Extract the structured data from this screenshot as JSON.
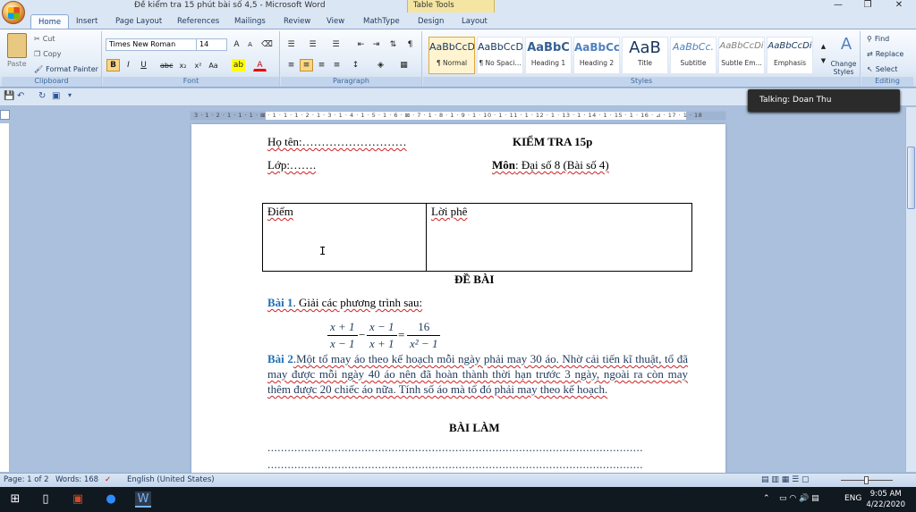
{
  "title_bar": {
    "document_title": "Đề kiểm tra 15 phút bài số 4,5 - Microsoft Word",
    "contextual_tab": "Table Tools",
    "minimize": "—",
    "restore": "❐",
    "close": "✕"
  },
  "tabs": [
    "Home",
    "Insert",
    "Page Layout",
    "References",
    "Mailings",
    "Review",
    "View",
    "MathType",
    "Design",
    "Layout"
  ],
  "clipboard": {
    "paste": "Paste",
    "cut": "Cut",
    "copy": "Copy",
    "format_painter": "Format Painter",
    "group_label": "Clipboard"
  },
  "font": {
    "family": "Times New Roman",
    "size": "14",
    "group_label": "Font"
  },
  "paragraph": {
    "group_label": "Paragraph"
  },
  "styles": {
    "items": [
      {
        "preview": "AaBbCcDc",
        "name": "¶ Normal"
      },
      {
        "preview": "AaBbCcDc",
        "name": "¶ No Spaci..."
      },
      {
        "preview": "AaBbC",
        "name": "Heading 1"
      },
      {
        "preview": "AaBbCc",
        "name": "Heading 2"
      },
      {
        "preview": "AaB",
        "name": "Title"
      },
      {
        "preview": "AaBbCc.",
        "name": "Subtitle"
      },
      {
        "preview": "AaBbCcDi",
        "name": "Subtle Em..."
      },
      {
        "preview": "AaBbCcDi",
        "name": "Emphasis"
      }
    ],
    "change_styles": "Change Styles",
    "group_label": "Styles"
  },
  "editing": {
    "find": "Find",
    "replace": "Replace",
    "select": "Select",
    "group_label": "Editing"
  },
  "talking": "Talking: Doan Thu",
  "ruler_text": "3 · 1 · 2 · 1 · 1 · 1 · ⊠ · 1 · 1 · 1 · 2 · 1 · 3 · 1 · 4 · 1 · 5 · 1 · 6 · ⊠ · 7 · 1 · 8 · 1 · 9 · 1 · 10 · 1 · 11 · 1 · 12 · 1 · 13 · 1 · 14 · 1 · 15 · 1 · 16 · ⊿ · 17 · 1 · 18",
  "document": {
    "name_label": "Họ tên:………………………",
    "class_label": "Lớp:…….",
    "test_title": "KIỂM TRA 15p",
    "subject_label": "Môn",
    "subject_value": ": Đại số  8 (Bài số 4)",
    "table_col1": "Điểm",
    "table_col2": "Lời phê",
    "de_bai": "ĐỀ BÀI",
    "bai1_label": "Bài 1",
    "bai1_text": ". Giải các phương trình sau:",
    "eq_frac1_num": "x + 1",
    "eq_frac1_den": "x − 1",
    "eq_frac2_num": "x − 1",
    "eq_frac2_den": "x + 1",
    "eq_frac3_num": "16",
    "eq_frac3_den": "x² − 1",
    "eq_minus": "−",
    "eq_equals": "=",
    "bai2_label": "Bài 2",
    "bai2_text": ".Một tổ may áo theo kế hoạch mỗi ngày phải may 30 áo. Nhờ cải tiến kĩ thuật, tổ đã may được mỗi ngày 40 áo nên đã hoàn thành thời hạn trước 3 ngày, ngoài ra còn may thêm được 20 chiếc áo nữa. Tính số áo mà tổ đó phải may theo kế hoạch.",
    "bai_lam": "BÀI LÀM",
    "dot_line": "................................................................................................................",
    "dot_line2": "................................................................................................................"
  },
  "status_bar": {
    "page": "Page: 1 of 2",
    "words": "Words: 168",
    "language": "English (United States)"
  },
  "taskbar": {
    "language": "ENG",
    "time": "9:05 AM",
    "date": "4/22/2020"
  }
}
